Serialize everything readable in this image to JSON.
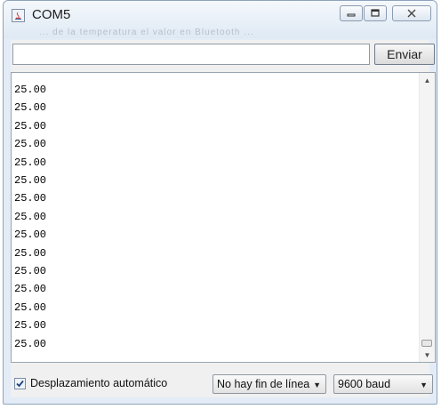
{
  "window": {
    "title": "COM5",
    "blurred_text": "...  de la temperatura  el valor en  Bluetooth  ..."
  },
  "send": {
    "input_value": "",
    "button_label": "Enviar"
  },
  "console": {
    "lines": [
      "25.00",
      "25.00",
      "25.00",
      "25.00",
      "25.00",
      "25.00",
      "25.00",
      "25.00",
      "25.00",
      "25.00",
      "25.00",
      "25.00",
      "25.00",
      "25.00",
      "25.00"
    ]
  },
  "footer": {
    "autoscroll_label": "Desplazamiento automático",
    "autoscroll_checked": true,
    "line_ending": "No hay fin de línea",
    "baud_rate": "9600 baud"
  },
  "icons": {
    "app": "java-app-icon",
    "minimize": "minimize-icon",
    "maximize": "maximize-icon",
    "close": "close-icon",
    "check": "check-icon",
    "caret": "chevron-down-icon"
  }
}
